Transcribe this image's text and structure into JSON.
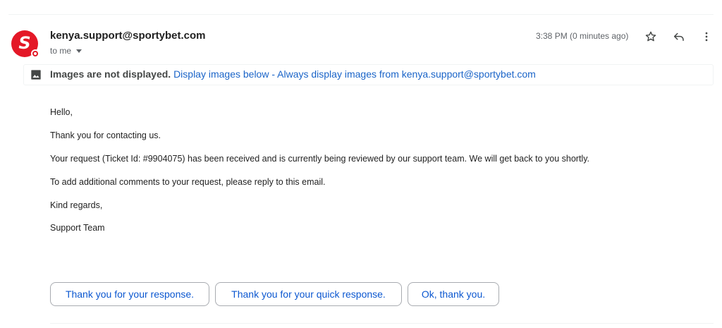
{
  "message": {
    "sender": "kenya.support@sportybet.com",
    "recipient": "to me",
    "timestamp": "3:38 PM (0 minutes ago)"
  },
  "icons": {
    "avatar": "sportybet-logo",
    "star": "star-icon",
    "reply": "reply-icon",
    "more": "more-vert-icon",
    "image": "image-icon",
    "caret": "chevron-down-icon"
  },
  "images_banner": {
    "notice": "Images are not displayed.",
    "display_below": "Display images below",
    "separator": " - ",
    "always_display": "Always display images from kenya.support@sportybet.com"
  },
  "body": {
    "greeting": "Hello,",
    "line1": "Thank you for contacting us.",
    "line2": "Your request (Ticket Id: #9904075) has been received and is currently being reviewed by our support team. We will get back to you shortly.",
    "line3": "To add additional comments to your request, please reply to this email.",
    "closing": "Kind regards,",
    "signature": "Support Team"
  },
  "quick_replies": [
    "Thank you for your response.",
    "Thank you for your quick response.",
    "Ok, thank you."
  ],
  "colors": {
    "brand_red": "#e41827",
    "link_blue": "#1a64c8",
    "button_text": "#0b57d0"
  }
}
